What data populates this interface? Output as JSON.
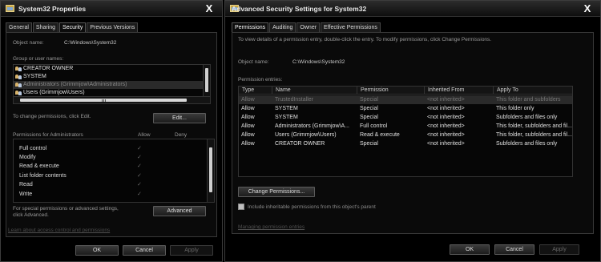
{
  "left": {
    "title": "System32 Properties",
    "close_glyph": "X",
    "tabs": [
      "General",
      "Sharing",
      "Security",
      "Previous Versions"
    ],
    "active_tab": "Security",
    "object_name_label": "Object name:",
    "object_name_value": "C:\\Windows\\System32",
    "group_label": "Group or user names:",
    "groups": [
      {
        "name": "CREATOR OWNER",
        "selected": false
      },
      {
        "name": "SYSTEM",
        "selected": false
      },
      {
        "name": "Administrators (Grimmjow\\Administrators)",
        "selected": true
      },
      {
        "name": "Users (Grimmjow\\Users)",
        "selected": false
      }
    ],
    "change_perm_text": "To change permissions, click Edit.",
    "edit_label": "Edit...",
    "perms_header": "Permissions for Administrators",
    "allow_header": "Allow",
    "deny_header": "Deny",
    "permissions": [
      {
        "name": "Full control",
        "allow": "✓"
      },
      {
        "name": "Modify",
        "allow": "✓"
      },
      {
        "name": "Read & execute",
        "allow": "✓"
      },
      {
        "name": "List folder contents",
        "allow": "✓"
      },
      {
        "name": "Read",
        "allow": "✓"
      },
      {
        "name": "Write",
        "allow": "✓"
      }
    ],
    "special_text_1": "For special permissions or advanced settings,",
    "special_text_2": "click Advanced.",
    "advanced_label": "Advanced",
    "learn_link": "Learn about access control and permissions",
    "ok_label": "OK",
    "cancel_label": "Cancel",
    "apply_label": "Apply"
  },
  "right": {
    "title": "Advanced Security Settings for System32",
    "close_glyph": "X",
    "tabs": [
      "Permissions",
      "Auditing",
      "Owner",
      "Effective Permissions"
    ],
    "active_tab": "Permissions",
    "intro": "To view details of a permission entry, double-click the entry. To modify permissions, click Change Permissions.",
    "object_name_label": "Object name:",
    "object_name_value": "C:\\Windows\\System32",
    "entries_label": "Permission entries:",
    "columns": [
      "Type",
      "Name",
      "Permission",
      "Inherited From",
      "Apply To"
    ],
    "entries": [
      {
        "type": "Allow",
        "name": "TrustedInstaller",
        "permission": "Special",
        "inherited": "<not inherited>",
        "apply": "This folder and subfolders",
        "selected": true
      },
      {
        "type": "Allow",
        "name": "SYSTEM",
        "permission": "Special",
        "inherited": "<not inherited>",
        "apply": "This folder only",
        "selected": false
      },
      {
        "type": "Allow",
        "name": "SYSTEM",
        "permission": "Special",
        "inherited": "<not inherited>",
        "apply": "Subfolders and files only",
        "selected": false
      },
      {
        "type": "Allow",
        "name": "Administrators (Grimmjow\\A...",
        "permission": "Full control",
        "inherited": "<not inherited>",
        "apply": "This folder, subfolders and fil...",
        "selected": false
      },
      {
        "type": "Allow",
        "name": "Users (Grimmjow\\Users)",
        "permission": "Read & execute",
        "inherited": "<not inherited>",
        "apply": "This folder, subfolders and fil...",
        "selected": false
      },
      {
        "type": "Allow",
        "name": "CREATOR OWNER",
        "permission": "Special",
        "inherited": "<not inherited>",
        "apply": "Subfolders and files only",
        "selected": false
      }
    ],
    "change_perms_label": "Change Permissions...",
    "include_label": "Include inheritable permissions from this object's parent",
    "managing_link": "Managing permission entries",
    "ok_label": "OK",
    "cancel_label": "Cancel",
    "apply_label": "Apply"
  }
}
